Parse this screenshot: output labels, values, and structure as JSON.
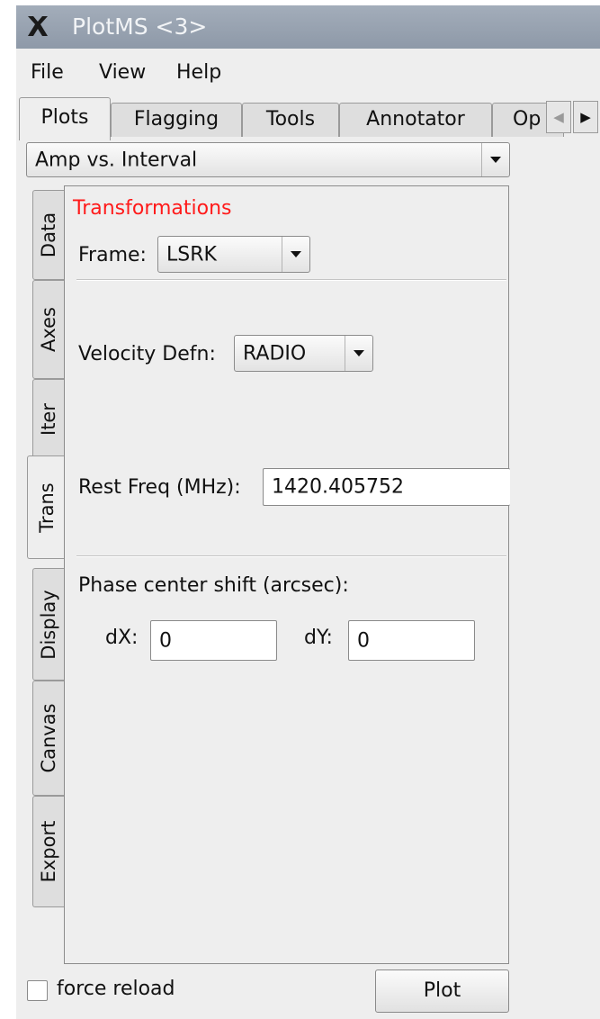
{
  "window": {
    "title": "PlotMS <3>",
    "logo_icon": "plotms-logo-icon"
  },
  "menu": {
    "file": "File",
    "view": "View",
    "help": "Help"
  },
  "tabs": [
    "Plots",
    "Flagging",
    "Tools",
    "Annotator",
    "Op"
  ],
  "tab_scroll": {
    "left_icon": "chevron-left-icon",
    "right_icon": "chevron-right-icon"
  },
  "plot_selector": {
    "value": "Amp vs. Interval"
  },
  "side_tabs": [
    "Data",
    "Axes",
    "Iter",
    "Trans",
    "Display",
    "Canvas",
    "Export"
  ],
  "active_side_tab": "Trans",
  "trans": {
    "heading": "Transformations",
    "frame_label": "Frame:",
    "frame_value": "LSRK",
    "velocity_label": "Velocity Defn:",
    "velocity_value": "RADIO",
    "restfreq_label": "Rest Freq (MHz):",
    "restfreq_value": "1420.405752",
    "phase_label": "Phase center shift (arcsec):",
    "dx_label": "dX:",
    "dx_value": "0",
    "dy_label": "dY:",
    "dy_value": "0"
  },
  "bottom": {
    "force_reload_label": "force reload",
    "force_reload_checked": false,
    "plot_button": "Plot"
  },
  "colors": {
    "heading_red": "#ff1a1a",
    "titlebar": "#97a2b0"
  }
}
